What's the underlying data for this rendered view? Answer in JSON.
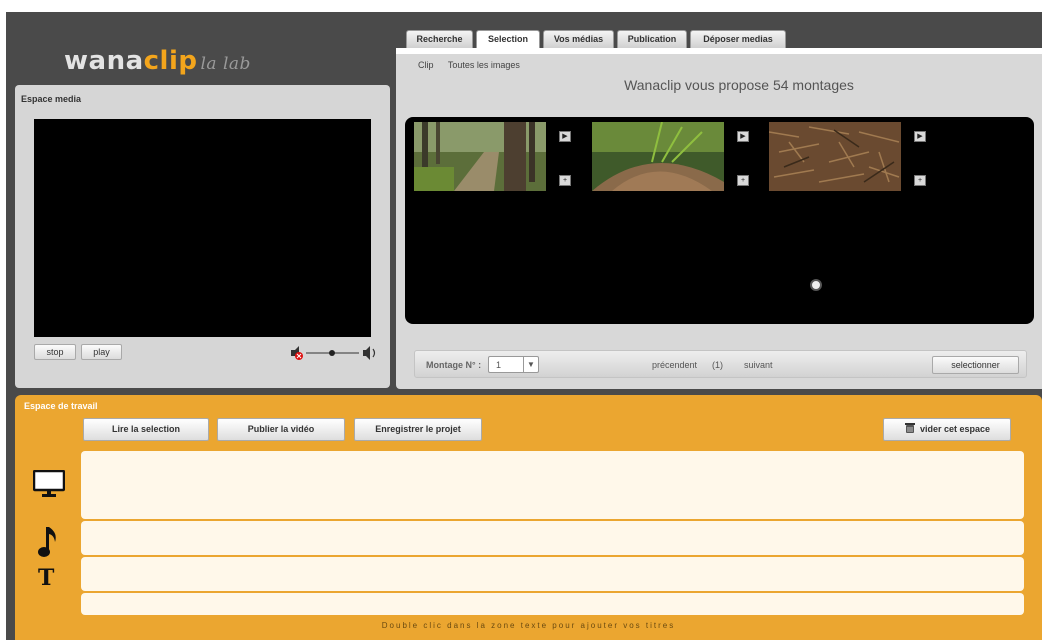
{
  "app": {
    "logo_main": "wana",
    "logo_accent": "clip",
    "logo_sub": "la lab"
  },
  "media_panel": {
    "title": "Espace media",
    "stop_label": "stop",
    "play_label": "play"
  },
  "tabs": [
    {
      "label": "Recherche",
      "active": false
    },
    {
      "label": "Selection",
      "active": true
    },
    {
      "label": "Vos médias",
      "active": false
    },
    {
      "label": "Publication",
      "active": false
    },
    {
      "label": "Déposer medias",
      "active": false
    }
  ],
  "selection": {
    "subnav": [
      "Clip",
      "Toutes les images"
    ],
    "proposal": "Wanaclip vous propose 54 montages",
    "clips": [
      {
        "name": "forest-path",
        "play_label": "▶",
        "add_label": "+"
      },
      {
        "name": "anthill",
        "play_label": "▶",
        "add_label": "+"
      },
      {
        "name": "pine-needles",
        "play_label": "▶",
        "add_label": "+"
      }
    ]
  },
  "pager": {
    "label": "Montage N° :",
    "value": "1",
    "prev": "précendent",
    "page": "(1)",
    "next": "suivant",
    "select_label": "selectionner"
  },
  "workspace": {
    "title": "Espace de travail",
    "read_label": "Lire la selection",
    "publish_label": "Publier la vidéo",
    "save_label": "Enregistrer le projet",
    "clear_label": "vider cet espace",
    "text_icon": "T",
    "hint": "Double clic dans la zone texte pour ajouter vos titres"
  },
  "colors": {
    "workspace_orange": "#eba630",
    "logo_accent": "#f3a51c",
    "dark_bg": "#4a4a4a"
  }
}
